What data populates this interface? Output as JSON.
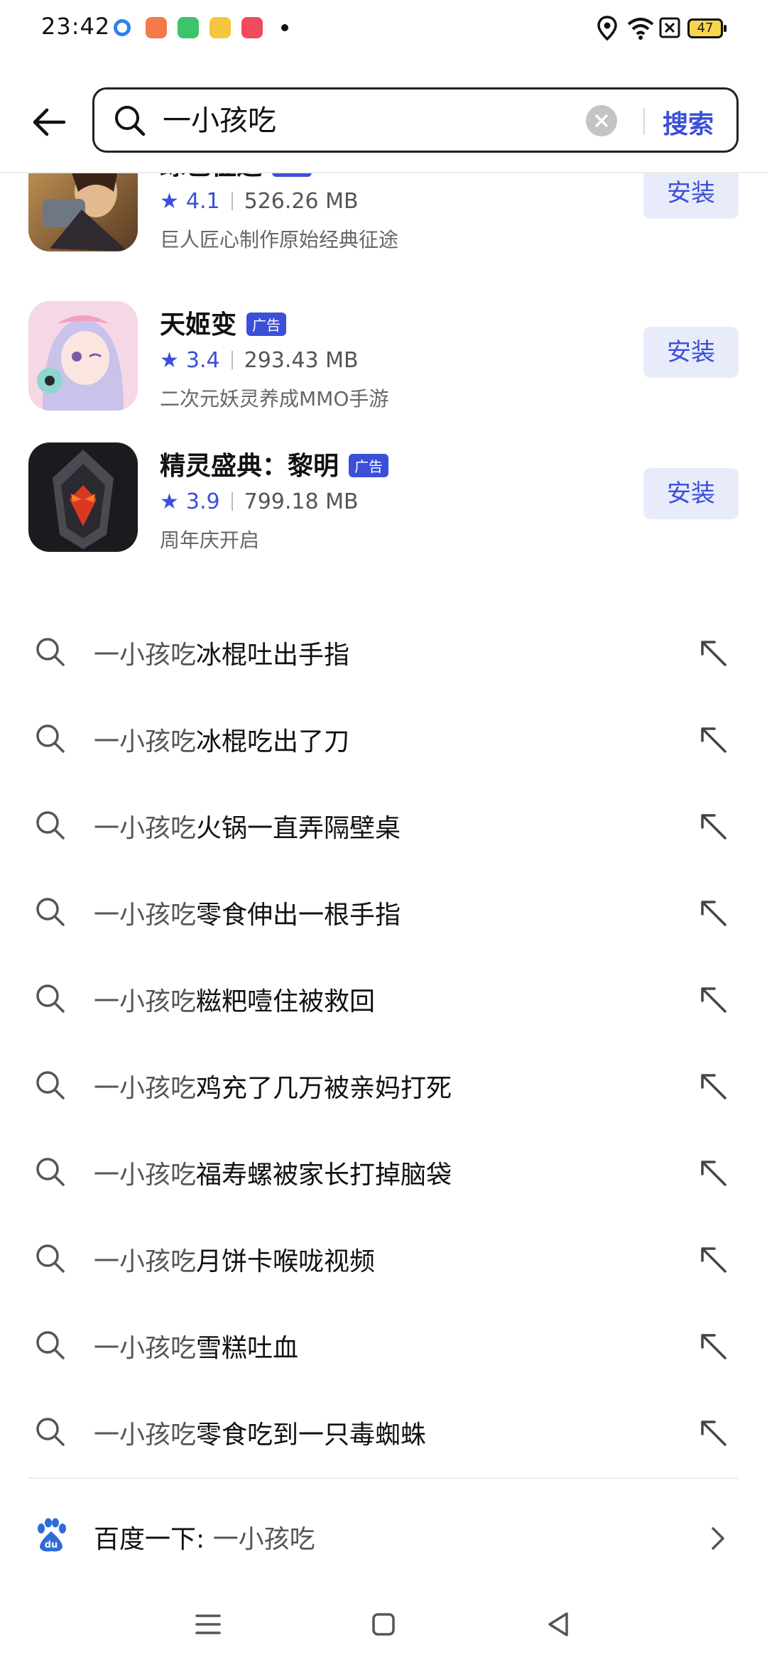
{
  "status_bar": {
    "time": "23:42",
    "battery": "47",
    "notification_icons": [
      "app-icon-blue-ring",
      "app-icon-orange",
      "app-icon-green",
      "app-icon-yellow",
      "app-icon-red-music"
    ]
  },
  "header": {
    "back_icon": "arrow-left-icon",
    "search_value": "一小孩吃",
    "search_button": "搜索"
  },
  "apps": [
    {
      "name": "绿色征途",
      "ad_label": "广告",
      "rating": "4.1",
      "size": "526.26 MB",
      "description": "巨人匠心制作原始经典征途",
      "install_label": "安装"
    },
    {
      "name": "天姬变",
      "ad_label": "广告",
      "rating": "3.4",
      "size": "293.43 MB",
      "description": "二次元妖灵养成MMO手游",
      "install_label": "安装"
    },
    {
      "name": "精灵盛典：黎明",
      "ad_label": "广告",
      "rating": "3.9",
      "size": "799.18 MB",
      "description": "周年庆开启",
      "install_label": "安装"
    }
  ],
  "suggestions": {
    "query": "一小孩吃",
    "items": [
      "冰棍吐出手指",
      "冰棍吃出了刀",
      "火锅一直弄隔壁桌",
      "零食伸出一根手指",
      "糍粑噎住被救回",
      "鸡充了几万被亲妈打死",
      "福寿螺被家长打掉脑袋",
      "月饼卡喉咙视频",
      "雪糕吐血",
      "零食吃到一只毒蜘蛛"
    ]
  },
  "baidu": {
    "label": "百度一下: ",
    "query": "一小孩吃"
  },
  "colors": {
    "accent": "#3b4fd8",
    "install_bg": "#e8ecfa",
    "text_primary": "#111111",
    "text_secondary": "#555555"
  }
}
